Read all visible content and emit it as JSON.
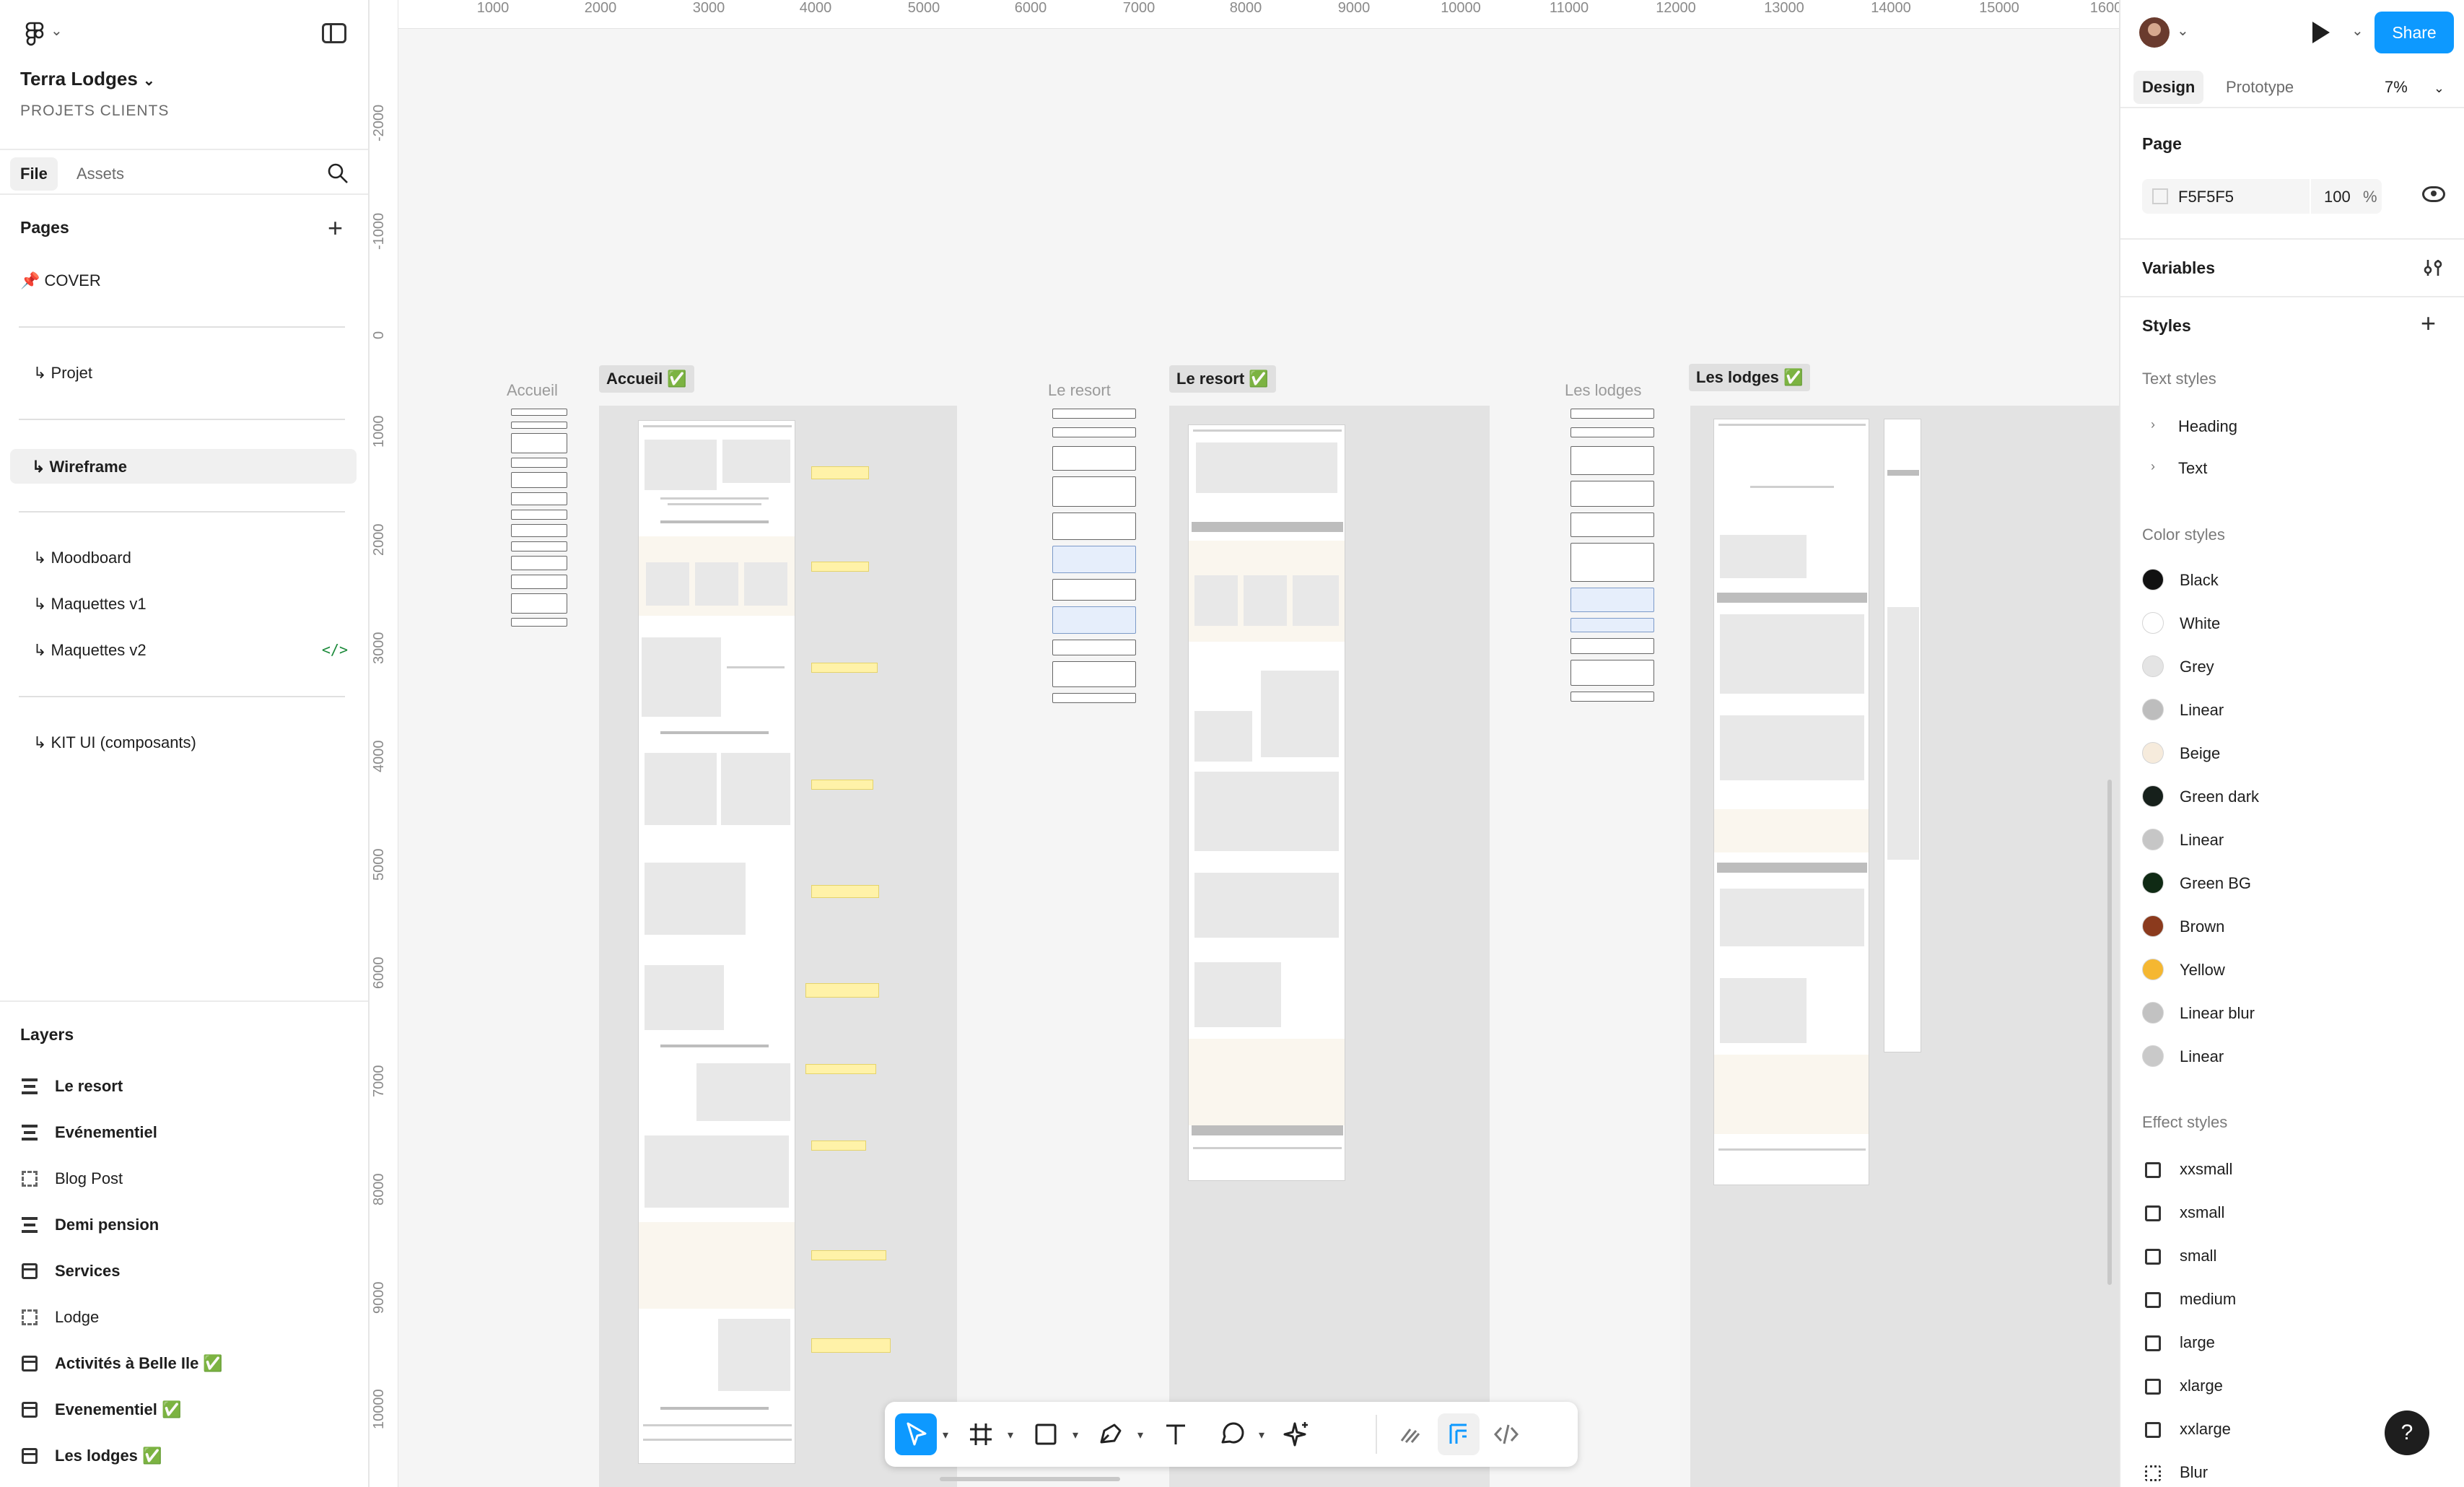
{
  "project": {
    "title": "Terra Lodges",
    "subtitle": "PROJETS CLIENTS"
  },
  "left_tabs": {
    "file": "File",
    "assets": "Assets"
  },
  "pages": {
    "heading": "Pages",
    "cover": "📌 COVER",
    "projet": "↳ Projet",
    "wireframe": "↳ Wireframe",
    "moodboard": "↳ Moodboard",
    "maquettes_v1": "↳ Maquettes v1",
    "maquettes_v2": "↳ Maquettes v2",
    "kit_ui": "↳ KIT UI (composants)",
    "code_badge": "</>"
  },
  "layers": {
    "heading": "Layers",
    "items": [
      {
        "label": "Le resort",
        "icon": "section-icon",
        "bold": true
      },
      {
        "label": "Evénementiel",
        "icon": "section-icon",
        "bold": true
      },
      {
        "label": "Blog Post",
        "icon": "frame-icon",
        "bold": false
      },
      {
        "label": "Demi pension",
        "icon": "section-icon",
        "bold": true
      },
      {
        "label": "Services",
        "icon": "box-icon",
        "bold": true
      },
      {
        "label": "Lodge",
        "icon": "frame-icon",
        "bold": false
      },
      {
        "label": "Activités à Belle Ile ✅",
        "icon": "box-icon",
        "bold": true
      },
      {
        "label": "Evenementiel ✅",
        "icon": "box-icon",
        "bold": true
      },
      {
        "label": "Les lodges ✅",
        "icon": "box-icon",
        "bold": true
      }
    ]
  },
  "ruler": {
    "top": [
      "1000",
      "2000",
      "3000",
      "4000",
      "5000",
      "6000",
      "7000",
      "8000",
      "9000",
      "10000",
      "11000",
      "12000",
      "13000",
      "14000",
      "15000",
      "1600"
    ],
    "left": [
      "-2000",
      "-1000",
      "0",
      "1000",
      "2000",
      "3000",
      "4000",
      "5000",
      "6000",
      "7000",
      "8000",
      "9000",
      "10000"
    ]
  },
  "canvas_frames": {
    "accueil_muted": "Accueil",
    "accueil_tag": "Accueil ✅",
    "resort_muted": "Le resort",
    "resort_tag": "Le resort ✅",
    "lodges_muted": "Les lodges",
    "lodges_tag": "Les lodges ✅"
  },
  "right_panel": {
    "share": "Share",
    "tab_design": "Design",
    "tab_prototype": "Prototype",
    "zoom": "7%",
    "page_heading": "Page",
    "page_fill_hex": "F5F5F5",
    "page_fill_opacity": "100",
    "page_fill_pct": "%",
    "variables_heading": "Variables",
    "styles_heading": "Styles",
    "text_styles_heading": "Text styles",
    "text_styles": [
      "Heading",
      "Text"
    ],
    "color_styles_heading": "Color styles",
    "color_styles": [
      {
        "label": "Black",
        "color": "#111111"
      },
      {
        "label": "White",
        "color": "#ffffff"
      },
      {
        "label": "Grey",
        "color": "#e4e4e4"
      },
      {
        "label": "Linear",
        "color": "#bdbdbd"
      },
      {
        "label": "Beige",
        "color": "#f6ebdc"
      },
      {
        "label": "Green dark",
        "color": "#16201b"
      },
      {
        "label": "Linear",
        "color": "#c6c6c6"
      },
      {
        "label": "Green BG",
        "color": "#0f2a14"
      },
      {
        "label": "Brown",
        "color": "#8b3a1d"
      },
      {
        "label": "Yellow",
        "color": "#f5b731"
      },
      {
        "label": "Linear blur",
        "color": "#c2c2c2"
      },
      {
        "label": "Linear",
        "color": "#c9c9c9"
      }
    ],
    "effect_styles_heading": "Effect styles",
    "effect_styles": [
      "xxsmall",
      "xsmall",
      "small",
      "medium",
      "large",
      "xlarge",
      "xxlarge",
      "Blur"
    ],
    "help": "?"
  },
  "toolbar": {
    "tools": [
      "move-tool",
      "frame-tool",
      "shape-tool",
      "pen-tool",
      "text-tool",
      "comment-tool",
      "actions-tool"
    ],
    "modes": [
      "draw-mode",
      "design-mode",
      "dev-mode"
    ]
  }
}
